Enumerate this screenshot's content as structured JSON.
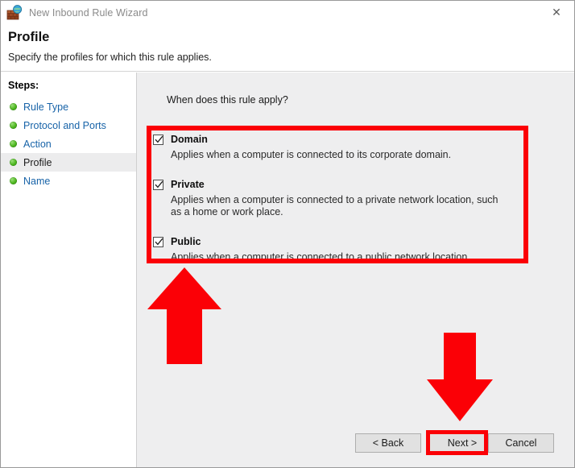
{
  "window": {
    "title": "New Inbound Rule Wizard",
    "icon": "firewall-brick-globe-icon",
    "close_label": "✕"
  },
  "header": {
    "title": "Profile",
    "subtitle": "Specify the profiles for which this rule applies."
  },
  "sidebar": {
    "heading": "Steps:",
    "items": [
      {
        "label": "Rule Type",
        "current": false
      },
      {
        "label": "Protocol and Ports",
        "current": false
      },
      {
        "label": "Action",
        "current": false
      },
      {
        "label": "Profile",
        "current": true
      },
      {
        "label": "Name",
        "current": false
      }
    ]
  },
  "main": {
    "question": "When does this rule apply?",
    "options": [
      {
        "label": "Domain",
        "checked": true,
        "description": "Applies when a computer is connected to its corporate domain."
      },
      {
        "label": "Private",
        "checked": true,
        "description": "Applies when a computer is connected to a private network location, such as a home or work place."
      },
      {
        "label": "Public",
        "checked": true,
        "description": "Applies when a computer is connected to a public network location."
      }
    ]
  },
  "buttons": {
    "back": "< Back",
    "next": "Next >",
    "cancel": "Cancel"
  },
  "annotations": {
    "highlight_color": "#fb0006",
    "options_box": "red-rectangle-around-profile-options",
    "arrow_up": "red-arrow-pointing-up-at-options",
    "arrow_down": "red-arrow-pointing-down-at-next-button",
    "next_box": "red-rectangle-around-next-button"
  }
}
